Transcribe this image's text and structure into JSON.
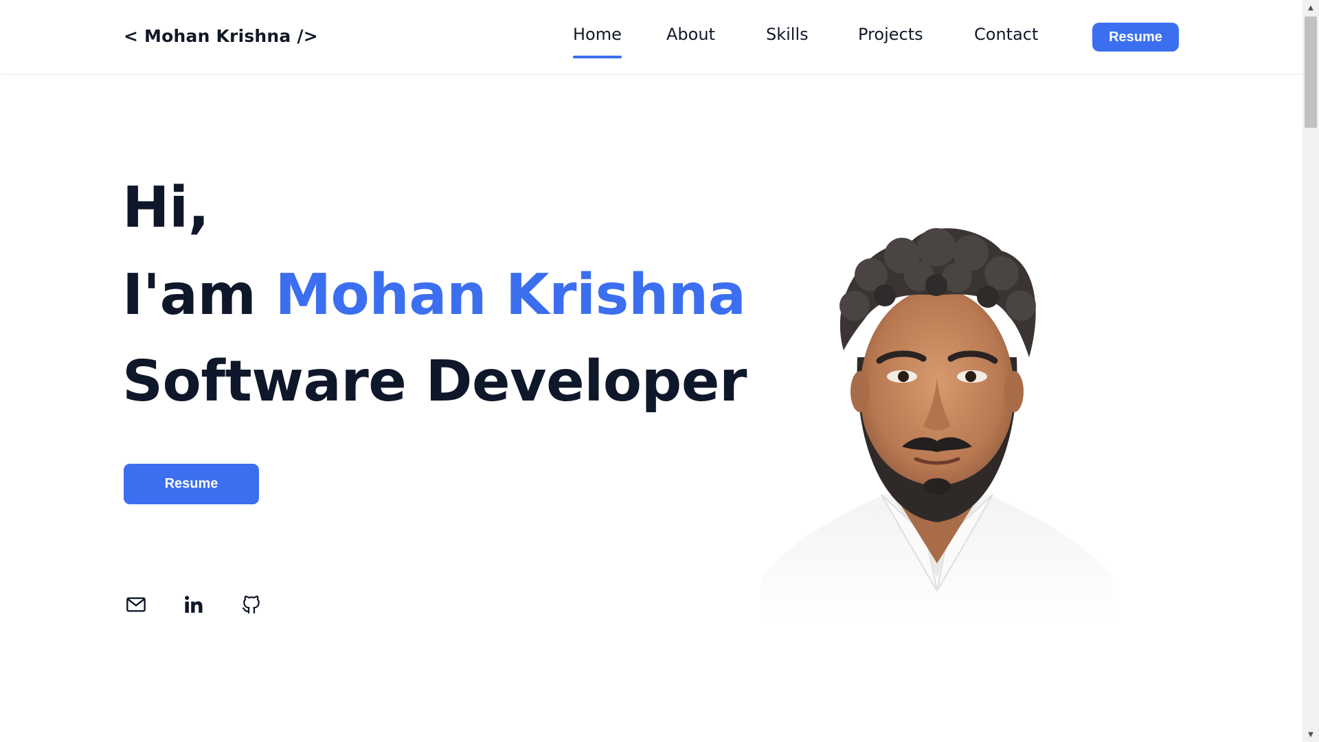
{
  "header": {
    "logo": "< Mohan Krishna />",
    "nav": [
      {
        "label": "Home",
        "active": true
      },
      {
        "label": "About",
        "active": false
      },
      {
        "label": "Skills",
        "active": false
      },
      {
        "label": "Projects",
        "active": false
      },
      {
        "label": "Contact",
        "active": false
      }
    ],
    "resume_label": "Resume"
  },
  "hero": {
    "greeting": "Hi,",
    "intro_prefix": "I'am ",
    "name": "Mohan Krishna",
    "role": "Software Developer",
    "resume_label": "Resume",
    "socials": [
      {
        "icon": "mail-icon"
      },
      {
        "icon": "linkedin-icon"
      },
      {
        "icon": "github-icon"
      }
    ],
    "portrait_alt": "profile-photo"
  },
  "scrollbar": {
    "up_arrow": "▲",
    "down_arrow": "▼"
  },
  "colors": {
    "accent": "#3b6ff0",
    "text": "#0f172a",
    "background": "#ffffff"
  }
}
